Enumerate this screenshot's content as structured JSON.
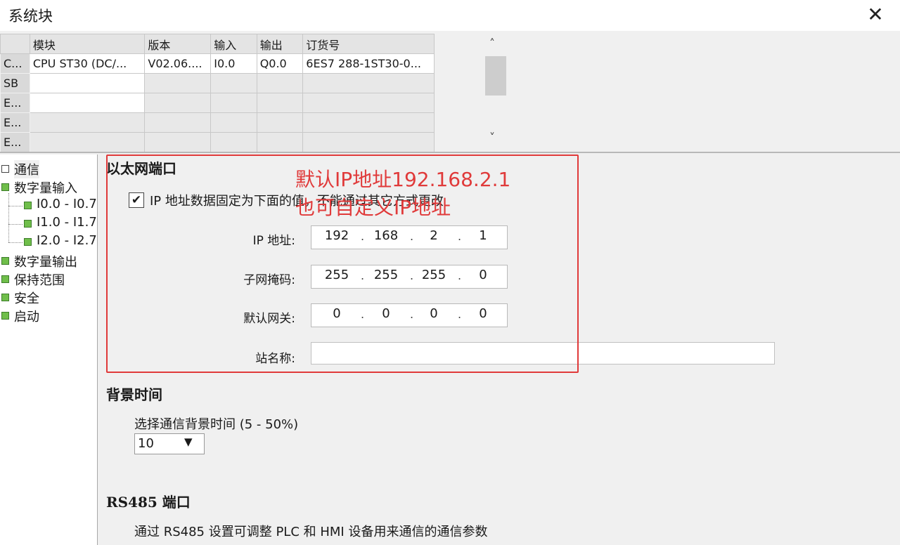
{
  "window": {
    "title": "系统块",
    "close_glyph": "✕"
  },
  "module_grid": {
    "columns": [
      "",
      "模块",
      "版本",
      "输入",
      "输出",
      "订货号"
    ],
    "rows": [
      {
        "head": "C...",
        "module": "CPU ST30 (DC/...",
        "version": "V02.06....",
        "input": "I0.0",
        "output": "Q0.0",
        "order": "6ES7 288-1ST30-0..."
      },
      {
        "head": "SB",
        "module": "",
        "version": "",
        "input": "",
        "output": "",
        "order": ""
      },
      {
        "head": "E...",
        "module": "",
        "version": "",
        "input": "",
        "output": "",
        "order": ""
      },
      {
        "head": "E...",
        "module": "",
        "version": "",
        "input": "",
        "output": "",
        "order": ""
      },
      {
        "head": "E...",
        "module": "",
        "version": "",
        "input": "",
        "output": "",
        "order": ""
      }
    ]
  },
  "scrollbar": {
    "up": "˄",
    "down": "˅"
  },
  "tree": {
    "items": [
      {
        "label": "通信",
        "selected": true
      },
      {
        "label": "数字量输入"
      },
      {
        "label": "I0.0 - I0.7"
      },
      {
        "label": "I1.0 - I1.7"
      },
      {
        "label": "I2.0 - I2.7"
      },
      {
        "label": "数字量输出"
      },
      {
        "label": "保持范围"
      },
      {
        "label": "安全"
      },
      {
        "label": "启动"
      }
    ]
  },
  "ethernet": {
    "title": "以太网端口",
    "fixed_ip_checkbox": {
      "checked": true,
      "label": "IP 地址数据固定为下面的值，不能通过其它方式更改"
    },
    "ip_label": "IP 地址:",
    "ip": [
      "192",
      "168",
      "2",
      "1"
    ],
    "subnet_label": "子网掩码:",
    "subnet": [
      "255",
      "255",
      "255",
      "0"
    ],
    "gateway_label": "默认网关:",
    "gateway": [
      "0",
      "0",
      "0",
      "0"
    ],
    "station_label": "站名称:",
    "station_value": ""
  },
  "annotation": {
    "line1": "默认IP地址192.168.2.1",
    "line2": "也可自定义IP地址",
    "color": "#e03a3a"
  },
  "background_time": {
    "title": "背景时间",
    "label": "选择通信背景时间 (5 - 50%)",
    "value": "10",
    "arrow": "▼"
  },
  "rs485": {
    "title": "RS485 端口",
    "description": "通过 RS485 设置可调整 PLC 和 HMI 设备用来通信的通信参数"
  }
}
